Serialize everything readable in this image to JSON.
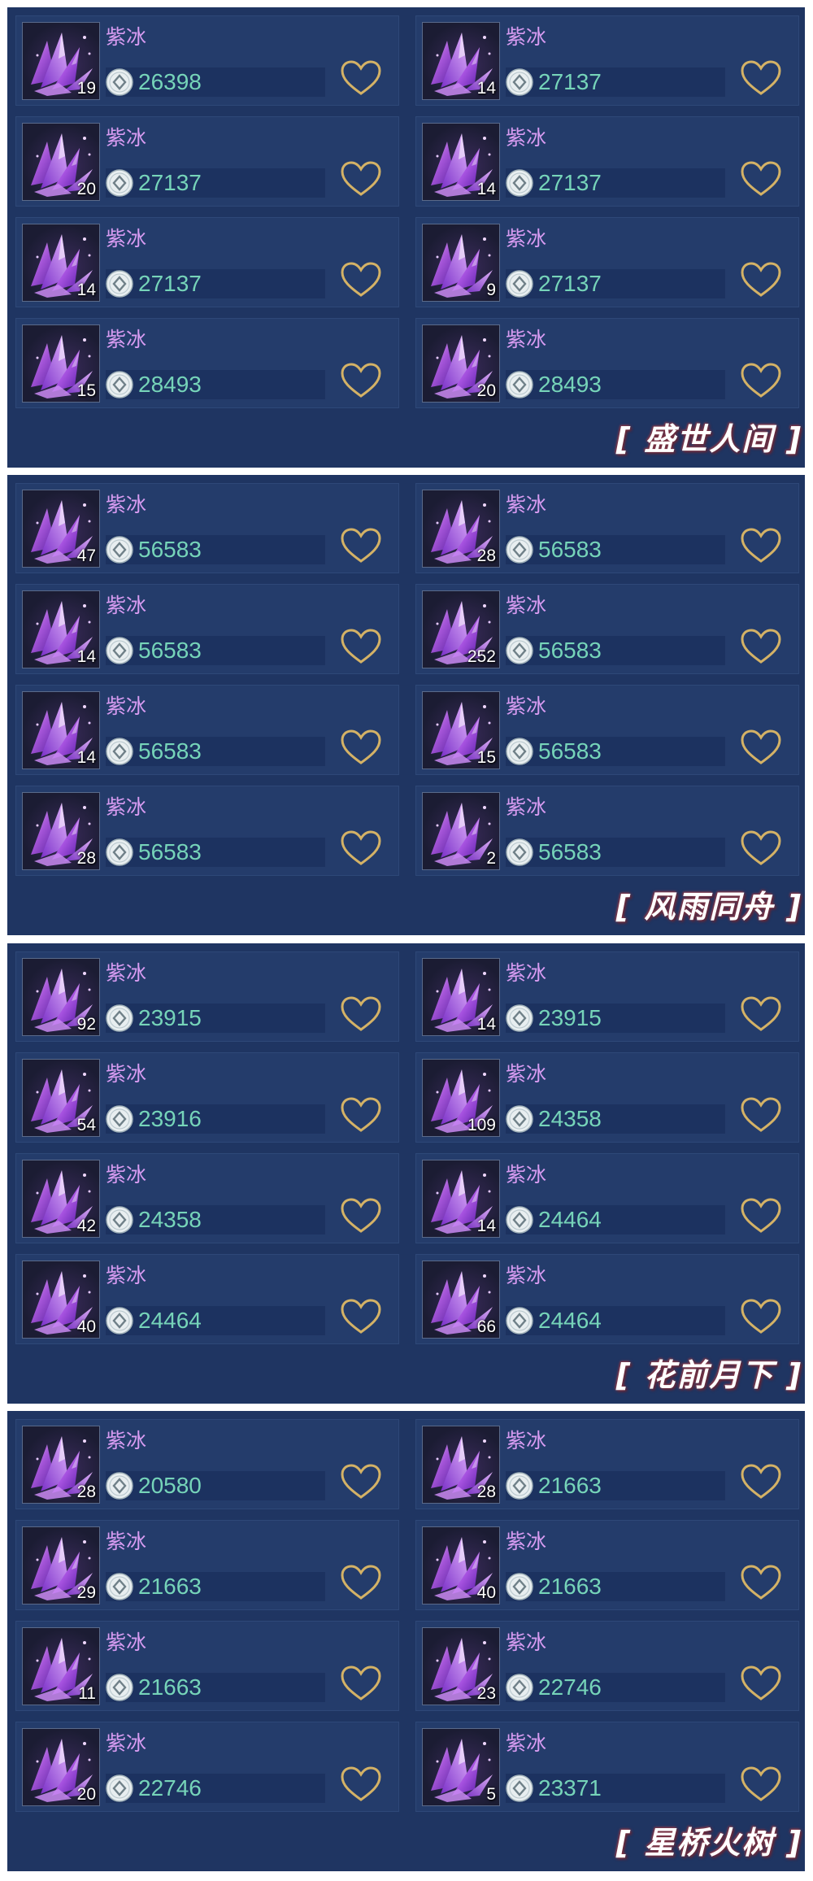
{
  "colors": {
    "panel_bg": "#1f3562",
    "card_bg": "#243c6b",
    "item_name": "#d89cf2",
    "price_text": "#76d4b9",
    "heart": "#d4b266"
  },
  "icons": {
    "item": "purple-crystal-icon",
    "currency": "silver-coin-icon",
    "favorite": "heart-outline-icon"
  },
  "sections": [
    {
      "label": "[ 盛世人间 ]",
      "items": [
        {
          "name": "紫冰",
          "qty": "19",
          "price": "26398"
        },
        {
          "name": "紫冰",
          "qty": "14",
          "price": "27137"
        },
        {
          "name": "紫冰",
          "qty": "20",
          "price": "27137"
        },
        {
          "name": "紫冰",
          "qty": "14",
          "price": "27137"
        },
        {
          "name": "紫冰",
          "qty": "14",
          "price": "27137"
        },
        {
          "name": "紫冰",
          "qty": "9",
          "price": "27137"
        },
        {
          "name": "紫冰",
          "qty": "15",
          "price": "28493"
        },
        {
          "name": "紫冰",
          "qty": "20",
          "price": "28493"
        }
      ]
    },
    {
      "label": "[ 风雨同舟 ]",
      "items": [
        {
          "name": "紫冰",
          "qty": "47",
          "price": "56583"
        },
        {
          "name": "紫冰",
          "qty": "28",
          "price": "56583"
        },
        {
          "name": "紫冰",
          "qty": "14",
          "price": "56583"
        },
        {
          "name": "紫冰",
          "qty": "252",
          "price": "56583"
        },
        {
          "name": "紫冰",
          "qty": "14",
          "price": "56583"
        },
        {
          "name": "紫冰",
          "qty": "15",
          "price": "56583"
        },
        {
          "name": "紫冰",
          "qty": "28",
          "price": "56583"
        },
        {
          "name": "紫冰",
          "qty": "2",
          "price": "56583"
        }
      ]
    },
    {
      "label": "[ 花前月下 ]",
      "items": [
        {
          "name": "紫冰",
          "qty": "92",
          "price": "23915"
        },
        {
          "name": "紫冰",
          "qty": "14",
          "price": "23915"
        },
        {
          "name": "紫冰",
          "qty": "54",
          "price": "23916"
        },
        {
          "name": "紫冰",
          "qty": "109",
          "price": "24358"
        },
        {
          "name": "紫冰",
          "qty": "42",
          "price": "24358"
        },
        {
          "name": "紫冰",
          "qty": "14",
          "price": "24464"
        },
        {
          "name": "紫冰",
          "qty": "40",
          "price": "24464"
        },
        {
          "name": "紫冰",
          "qty": "66",
          "price": "24464"
        }
      ]
    },
    {
      "label": "[ 星桥火树 ]",
      "items": [
        {
          "name": "紫冰",
          "qty": "28",
          "price": "20580"
        },
        {
          "name": "紫冰",
          "qty": "28",
          "price": "21663"
        },
        {
          "name": "紫冰",
          "qty": "29",
          "price": "21663"
        },
        {
          "name": "紫冰",
          "qty": "40",
          "price": "21663"
        },
        {
          "name": "紫冰",
          "qty": "11",
          "price": "21663"
        },
        {
          "name": "紫冰",
          "qty": "23",
          "price": "22746"
        },
        {
          "name": "紫冰",
          "qty": "20",
          "price": "22746"
        },
        {
          "name": "紫冰",
          "qty": "5",
          "price": "23371"
        }
      ]
    }
  ]
}
